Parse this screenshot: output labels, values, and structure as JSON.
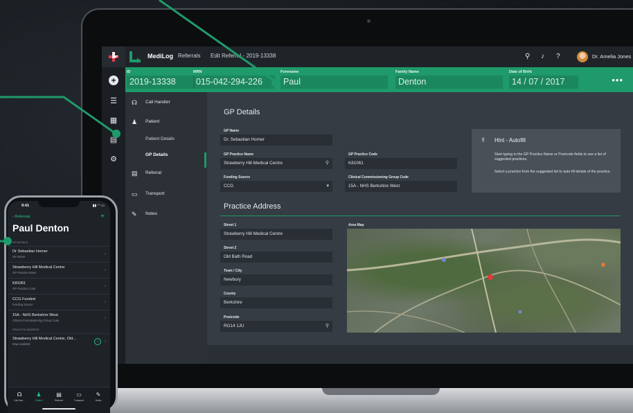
{
  "app": {
    "brand": "MediLog",
    "nav": [
      "Referrals",
      "Edit Referral - 2019-13338"
    ],
    "user": "Dr. Amelia Jones"
  },
  "patient_bar": {
    "id": {
      "label": "ID",
      "value": "2019-13338"
    },
    "mrn": {
      "label": "MRN",
      "value": "015-042-294-226"
    },
    "forename": {
      "label": "Forename",
      "value": "Paul"
    },
    "family": {
      "label": "Family Name",
      "value": "Denton"
    },
    "dob": {
      "label": "Date of Birth",
      "value": "14 / 07 / 2017"
    },
    "more": "•••"
  },
  "menu": {
    "call_handler": "Call Handler",
    "patient": "Patient",
    "patient_details": "Patient Details",
    "gp_details": "GP Details",
    "referral": "Referral",
    "transport": "Transport",
    "notes": "Notes"
  },
  "gp": {
    "heading": "GP Details",
    "gp_name_label": "GP Name",
    "gp_name": "Dr. Sebastian Horner",
    "practice_name_label": "GP Practice Name",
    "practice_name": "Strawberry Hill Medical Centre",
    "practice_code_label": "GP Practice Code",
    "practice_code": "K81061",
    "funding_label": "Funding Source",
    "funding": "CCG",
    "ccg_label": "Clinical Commissioning Group Code",
    "ccg": "15A - NHS Berkshire West"
  },
  "hint": {
    "title": "Hint - Autofill",
    "p1": "Start typing in the GP Practice Name or Postcode fields to see a list of suggested practices.",
    "p2": "Select a practice from the suggested list to auto-fill details of the practice."
  },
  "address": {
    "heading": "Practice Address",
    "street1_label": "Street 1",
    "street1": "Strawberry Hill Medical Centre",
    "street2_label": "Street 2",
    "street2": "Old Bath Road",
    "town_label": "Town / City",
    "town": "Newbury",
    "county_label": "County",
    "county": "Berkshire",
    "postcode_label": "Postcode",
    "postcode": "RG14 1JU",
    "map_label": "Area Map"
  },
  "phone": {
    "time": "9:41",
    "back": "Referrals",
    "title": "Paul Denton",
    "gp_section": "GP DETAILS",
    "rows": [
      {
        "a": "Dr Sebastian Horner",
        "b": "GP Name"
      },
      {
        "a": "Strawberry Hill Medical Centre",
        "b": "GP Practice Name"
      },
      {
        "a": "K81061",
        "b": "GP Practice Code"
      },
      {
        "a": "CCG Funded",
        "b": "Funding Source"
      },
      {
        "a": "15A - NHS Berkshire West",
        "b": "Clinical Commissioning Group Code"
      }
    ],
    "address_section": "PRACTICE ADDRESS",
    "address_row": {
      "a": "Strawberry Hill Medical Centre, Old...",
      "b": "Map available"
    },
    "tabs": [
      "Call Han...",
      "Patient",
      "Referral",
      "Transport",
      "Notes"
    ]
  },
  "colors": {
    "accent": "#1f9a6a",
    "accent_bright": "#27c083",
    "panel": "#363c43"
  }
}
